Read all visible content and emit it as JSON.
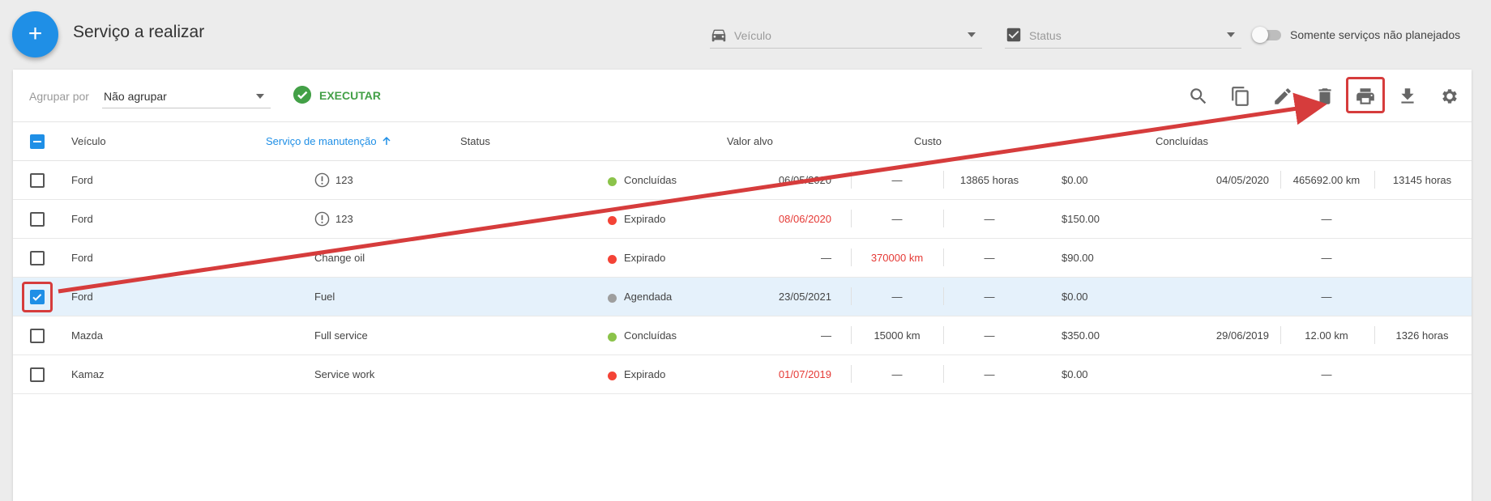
{
  "header": {
    "add_button_label": "+",
    "title": "Serviço a realizar",
    "vehicle_filter_placeholder": "Veículo",
    "status_filter_placeholder": "Status",
    "unplanned_toggle_label": "Somente serviços não planejados",
    "unplanned_toggle_on": false
  },
  "toolbar": {
    "group_by_label": "Agrupar por",
    "group_by_value": "Não agrupar",
    "execute_label": "EXECUTAR",
    "icons": [
      "search-icon",
      "copy-icon",
      "edit-icon",
      "delete-icon",
      "print-icon",
      "download-icon",
      "settings-icon"
    ]
  },
  "table": {
    "columns": {
      "vehicle": "Veículo",
      "service": "Serviço de manutenção",
      "status": "Status",
      "target": "Valor alvo",
      "cost": "Custo",
      "done": "Concluídas"
    },
    "rows": [
      {
        "checked": false,
        "vehicle": "Ford",
        "warn": true,
        "service": "123",
        "status": "Concluídas",
        "status_color": "#8bc34a",
        "date": "06/05/2020",
        "date_red": false,
        "km": "—",
        "km_red": false,
        "hours": "13865 horas",
        "cost": "$0.00",
        "done_date": "04/05/2020",
        "done_km": "465692.00 km",
        "done_hours": "13145 horas"
      },
      {
        "checked": false,
        "vehicle": "Ford",
        "warn": true,
        "service": "123",
        "status": "Expirado",
        "status_color": "#f44336",
        "date": "08/06/2020",
        "date_red": true,
        "km": "—",
        "km_red": false,
        "hours": "—",
        "cost": "$150.00",
        "done_date": "",
        "done_km": "—",
        "done_hours": ""
      },
      {
        "checked": false,
        "vehicle": "Ford",
        "warn": false,
        "service": "Change oil",
        "status": "Expirado",
        "status_color": "#f44336",
        "date": "—",
        "date_red": false,
        "km": "370000 km",
        "km_red": true,
        "hours": "—",
        "cost": "$90.00",
        "done_date": "",
        "done_km": "—",
        "done_hours": ""
      },
      {
        "checked": true,
        "vehicle": "Ford",
        "warn": false,
        "service": "Fuel",
        "status": "Agendada",
        "status_color": "#9e9e9e",
        "date": "23/05/2021",
        "date_red": false,
        "km": "—",
        "km_red": false,
        "hours": "—",
        "cost": "$0.00",
        "done_date": "",
        "done_km": "—",
        "done_hours": ""
      },
      {
        "checked": false,
        "vehicle": "Mazda",
        "warn": false,
        "service": "Full service",
        "status": "Concluídas",
        "status_color": "#8bc34a",
        "date": "—",
        "date_red": false,
        "km": "15000 km",
        "km_red": false,
        "hours": "—",
        "cost": "$350.00",
        "done_date": "29/06/2019",
        "done_km": "12.00 km",
        "done_hours": "1326 horas"
      },
      {
        "checked": false,
        "vehicle": "Kamaz",
        "warn": false,
        "service": "Service work",
        "status": "Expirado",
        "status_color": "#f44336",
        "date": "01/07/2019",
        "date_red": true,
        "km": "—",
        "km_red": false,
        "hours": "—",
        "cost": "$0.00",
        "done_date": "",
        "done_km": "—",
        "done_hours": ""
      }
    ]
  },
  "annotation": {
    "highlight_color": "#d63c3c"
  }
}
